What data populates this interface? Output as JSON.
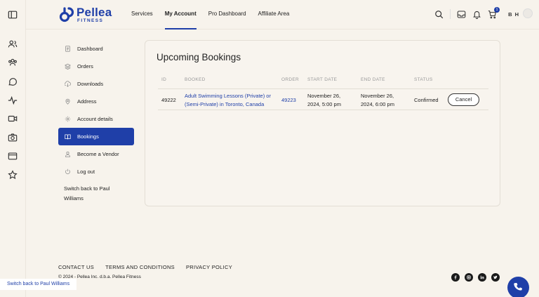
{
  "brand": {
    "name": "Pellea",
    "sub": "FITNESS",
    "color": "#1f3fa8"
  },
  "nav": {
    "items": [
      {
        "label": "Services"
      },
      {
        "label": "My Account",
        "active": true
      },
      {
        "label": "Pro Dashboard"
      },
      {
        "label": "Affiliate Area"
      }
    ],
    "cart_count": "1",
    "initials": "B H"
  },
  "rail_icons": [
    "sidebar-toggle-icon",
    "users-icon",
    "group-icon",
    "chat-icon",
    "activity-icon",
    "video-icon",
    "camera-icon",
    "folder-icon",
    "star-icon"
  ],
  "menu": {
    "items": [
      {
        "label": "Dashboard",
        "icon": "dashboard-icon"
      },
      {
        "label": "Orders",
        "icon": "orders-icon"
      },
      {
        "label": "Downloads",
        "icon": "download-icon"
      },
      {
        "label": "Address",
        "icon": "location-icon"
      },
      {
        "label": "Account details",
        "icon": "gear-icon"
      },
      {
        "label": "Bookings",
        "icon": "book-icon",
        "active": true
      },
      {
        "label": "Become a Vendor",
        "icon": "user-icon"
      },
      {
        "label": "Log out",
        "icon": "power-icon"
      }
    ],
    "switch_back": "Switch back to Paul Williams"
  },
  "bookings": {
    "title": "Upcoming Bookings",
    "columns": [
      "ID",
      "BOOKED",
      "ORDER",
      "START DATE",
      "END DATE",
      "STATUS"
    ],
    "rows": [
      {
        "id": "49222",
        "booked": "Adult Swimming Lessons (Private) or (Semi-Private) in Toronto, Canada",
        "order": "49223",
        "start": "November 26, 2024, 5:00 pm",
        "end": "November 26, 2024, 6:00 pm",
        "status": "Confirmed",
        "action": "Cancel"
      }
    ]
  },
  "footer": {
    "links": [
      "CONTACT US",
      "TERMS AND CONDITIONS",
      "PRIVACY POLICY"
    ],
    "copyright": "© 2024 - Pellea Inc. d.b.a. Pellea Fitness",
    "socials": [
      "facebook-icon",
      "instagram-icon",
      "linkedin-icon",
      "twitter-icon"
    ]
  },
  "switch_bar": "Switch back to Paul Williams"
}
